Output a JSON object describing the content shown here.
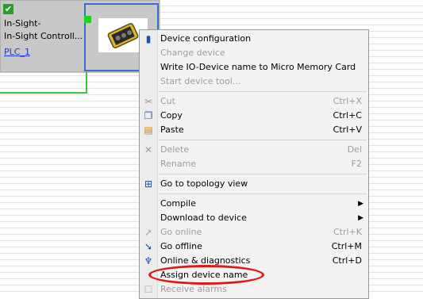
{
  "device": {
    "name": "In-Sight-",
    "type": "In-Sight Controll...",
    "plc_link": "PLC_1"
  },
  "menu": {
    "items": [
      {
        "label": "Device configuration",
        "shortcut": "",
        "enabled": true,
        "icon": "device-config-icon"
      },
      {
        "label": "Change device",
        "shortcut": "",
        "enabled": false,
        "icon": ""
      },
      {
        "label": "Write IO-Device name to Micro Memory Card",
        "shortcut": "",
        "enabled": true,
        "icon": ""
      },
      {
        "label": "Start device tool...",
        "shortcut": "",
        "enabled": false,
        "icon": ""
      },
      {
        "label": "Cut",
        "shortcut": "Ctrl+X",
        "enabled": false,
        "icon": "scissors-icon"
      },
      {
        "label": "Copy",
        "shortcut": "Ctrl+C",
        "enabled": true,
        "icon": "copy-icon"
      },
      {
        "label": "Paste",
        "shortcut": "Ctrl+V",
        "enabled": true,
        "icon": "paste-icon"
      },
      {
        "label": "Delete",
        "shortcut": "Del",
        "enabled": false,
        "icon": "delete-x-icon"
      },
      {
        "label": "Rename",
        "shortcut": "F2",
        "enabled": false,
        "icon": ""
      },
      {
        "label": "Go to topology view",
        "shortcut": "",
        "enabled": true,
        "icon": "topology-icon"
      },
      {
        "label": "Compile",
        "shortcut": "",
        "enabled": true,
        "icon": "",
        "submenu": true
      },
      {
        "label": "Download to device",
        "shortcut": "",
        "enabled": true,
        "icon": "",
        "submenu": true
      },
      {
        "label": "Go online",
        "shortcut": "Ctrl+K",
        "enabled": false,
        "icon": "go-online-icon"
      },
      {
        "label": "Go offline",
        "shortcut": "Ctrl+M",
        "enabled": true,
        "icon": "go-offline-icon"
      },
      {
        "label": "Online & diagnostics",
        "shortcut": "Ctrl+D",
        "enabled": true,
        "icon": "diagnostics-icon"
      },
      {
        "label": "Assign device name",
        "shortcut": "",
        "enabled": true,
        "icon": ""
      },
      {
        "label": "Receive alarms",
        "shortcut": "",
        "enabled": false,
        "icon": "checkbox-icon"
      }
    ]
  },
  "colors": {
    "annotation": "#e01818",
    "link": "#1a3cc8",
    "selection": "#3a6fd0",
    "connection": "#3fc43f"
  }
}
